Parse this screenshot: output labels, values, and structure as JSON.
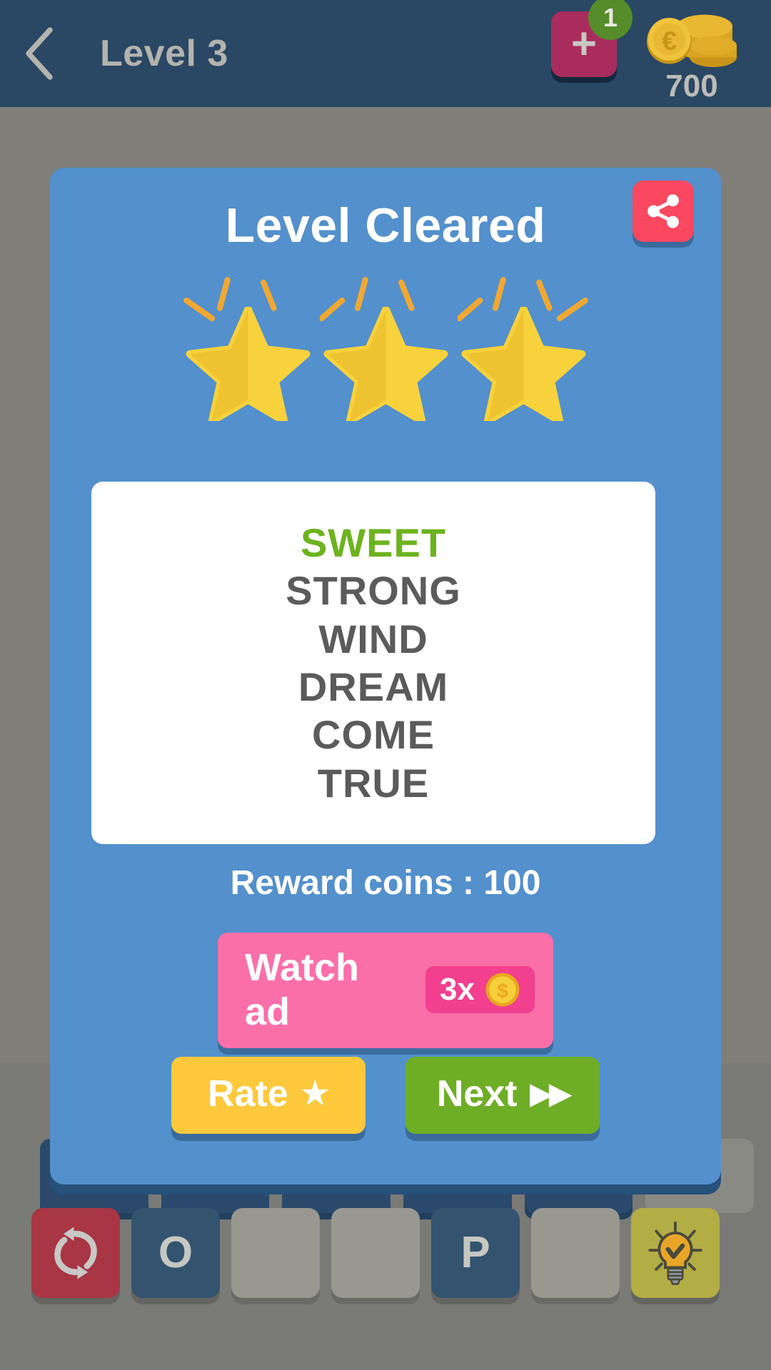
{
  "header": {
    "back_icon": "chevron-left-icon",
    "title": "Level 3",
    "add_button": {
      "icon": "plus-icon",
      "badge_count": "1"
    },
    "coins": {
      "icon": "coin-stack-euro-icon",
      "amount": "700"
    }
  },
  "dialog": {
    "title": "Level Cleared",
    "share_icon": "share-icon",
    "stars": {
      "count": 3,
      "filled_color": "#f8d23c"
    },
    "words": [
      {
        "text": "SWEET",
        "found": true
      },
      {
        "text": "STRONG",
        "found": false
      },
      {
        "text": "WIND",
        "found": false
      },
      {
        "text": "DREAM",
        "found": false
      },
      {
        "text": "COME",
        "found": false
      },
      {
        "text": "TRUE",
        "found": false
      }
    ],
    "reward_text": "Reward coins : 100",
    "watch_ad": {
      "label": "Watch ad",
      "multiplier": "3x",
      "coin_icon": "dollar-coin-icon"
    },
    "rate_button": {
      "label": "Rate",
      "icon": "star-icon",
      "glyph": "★"
    },
    "next_button": {
      "label": "Next",
      "icon": "fast-forward-icon",
      "glyph": "▶▶"
    }
  },
  "game_board": {
    "background_word_tiles": [
      {
        "state": "filled"
      },
      {
        "state": "filled"
      },
      {
        "state": "filled"
      },
      {
        "state": "filled"
      },
      {
        "state": "filled"
      },
      {
        "state": "empty"
      }
    ],
    "letter_row": [
      {
        "type": "shuffle",
        "icon": "shuffle-icon",
        "letter": ""
      },
      {
        "type": "letter",
        "icon": "",
        "letter": "O"
      },
      {
        "type": "empty",
        "icon": "",
        "letter": ""
      },
      {
        "type": "empty",
        "icon": "",
        "letter": ""
      },
      {
        "type": "letter",
        "icon": "",
        "letter": "P"
      },
      {
        "type": "empty",
        "icon": "",
        "letter": ""
      },
      {
        "type": "hint",
        "icon": "lightbulb-icon",
        "letter": ""
      }
    ]
  },
  "colors": {
    "header_bg": "#2a4763",
    "dialog_bg": "#5390cc",
    "overlay_bg": "#7d7c77",
    "accent_green": "#6cb31e",
    "accent_pink": "#fb6fa8",
    "accent_yellow": "#fdc83c",
    "accent_red": "#f9485f",
    "star_gold": "#f8d23c"
  }
}
